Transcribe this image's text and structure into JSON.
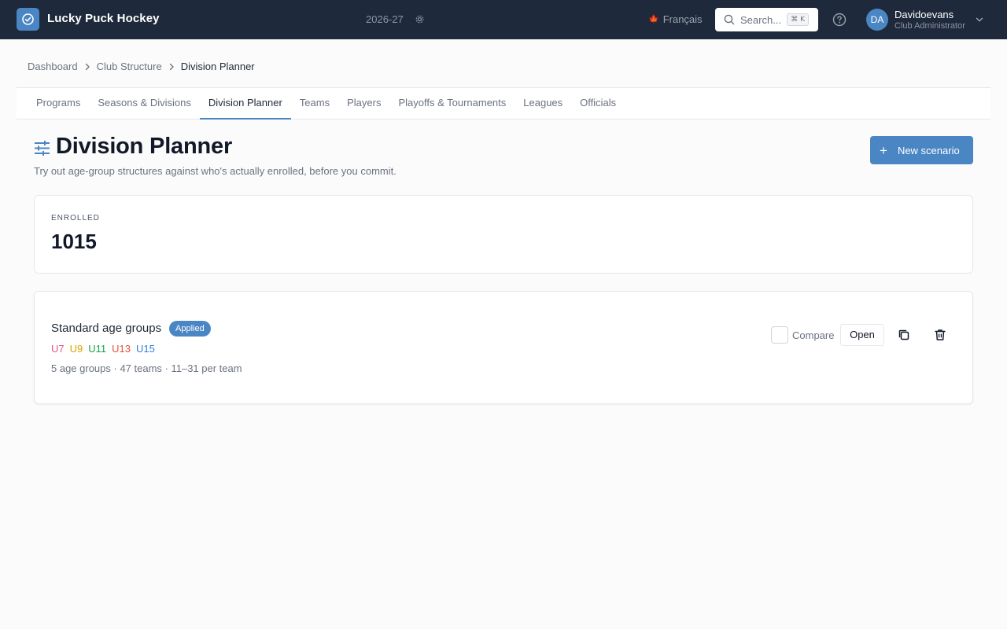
{
  "app": {
    "title": "Lucky Puck Hockey",
    "season": "2026-27"
  },
  "header": {
    "language_flag": "🍁",
    "language": "Français",
    "search_placeholder": "Search...",
    "search_shortcut": "⌘ K",
    "user": {
      "initials": "DA",
      "name": "Davidoevans",
      "role": "Club Administrator"
    }
  },
  "breadcrumb": {
    "items": [
      "Dashboard",
      "Club Structure"
    ],
    "current": "Division Planner"
  },
  "tabs": [
    {
      "label": "Programs"
    },
    {
      "label": "Seasons & Divisions"
    },
    {
      "label": "Division Planner",
      "active": true
    },
    {
      "label": "Teams"
    },
    {
      "label": "Players"
    },
    {
      "label": "Playoffs & Tournaments"
    },
    {
      "label": "Leagues"
    },
    {
      "label": "Officials"
    }
  ],
  "page": {
    "title": "Division Planner",
    "subtitle": "Try out age-group structures against who's actually enrolled, before you commit.",
    "new_button": "New scenario"
  },
  "enrolled": {
    "label": "ENROLLED",
    "value": "1015"
  },
  "scenario": {
    "name": "Standard age groups",
    "badge": "Applied",
    "age_groups": [
      {
        "label": "U7",
        "color": "#e8568f"
      },
      {
        "label": "U9",
        "color": "#e0a100"
      },
      {
        "label": "U11",
        "color": "#16a34a"
      },
      {
        "label": "U13",
        "color": "#e5533d"
      },
      {
        "label": "U15",
        "color": "#2f7fd9"
      }
    ],
    "meta": "5 age groups · 47 teams · 11–31 per team",
    "compare_label": "Compare",
    "open_label": "Open"
  },
  "colors": {
    "accent": "#4a86c4",
    "topbar": "#1e293b"
  }
}
